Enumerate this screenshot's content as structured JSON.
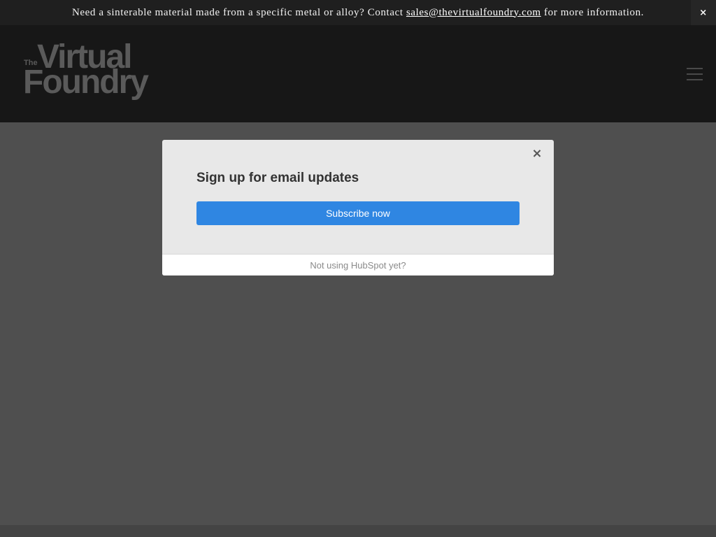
{
  "announcement": {
    "text_before": "Need a sinterable material made from a specific metal or alloy? Contact ",
    "email": "sales@thevirtualfoundry.com",
    "text_after": " for more information.",
    "close_glyph": "×"
  },
  "header": {
    "logo": {
      "the": "The",
      "line1": "Virtual",
      "line2": "Foundry"
    },
    "menu_icon": "hamburger-menu"
  },
  "modal": {
    "close_glyph": "×",
    "title": "Sign up for email updates",
    "subscribe_label": "Subscribe now",
    "footer_link": "Not using HubSpot yet?"
  },
  "colors": {
    "announcement_bg": "#1f1f1f",
    "header_bg": "#171717",
    "overlay_bg": "#4f4f4f",
    "modal_bg": "#e8e8e8",
    "button_blue": "#2f86e2"
  }
}
